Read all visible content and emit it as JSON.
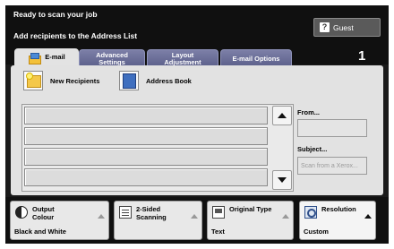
{
  "header": {
    "status_line": "Ready to scan your job",
    "instruction": "Add recipients to the Address List",
    "user_button": "Guest",
    "page_number": "1"
  },
  "tabs": [
    {
      "label": "E-mail",
      "active": true
    },
    {
      "label": "Advanced Settings",
      "active": false
    },
    {
      "label": "Layout Adjustment",
      "active": false
    },
    {
      "label": "E-mail Options",
      "active": false
    }
  ],
  "actions": {
    "new_recipients": "New Recipients",
    "address_book": "Address Book"
  },
  "recipient_list": {
    "rows": [
      "",
      "",
      "",
      ""
    ]
  },
  "fields": {
    "from_label": "From...",
    "from_value": "",
    "subject_label": "Subject...",
    "subject_placeholder": "Scan from a Xerox..."
  },
  "features": [
    {
      "title": "Output Colour",
      "value": "Black and White",
      "icon": "colour-icon"
    },
    {
      "title": "2-Sided Scanning",
      "value": "",
      "icon": "two-sided-icon"
    },
    {
      "title": "Original Type",
      "value": "Text",
      "icon": "original-type-icon"
    },
    {
      "title": "Resolution",
      "value": "Custom",
      "icon": "resolution-icon"
    }
  ],
  "colors": {
    "header_bg": "#101010",
    "tab_inactive": "#6b6f98",
    "panel_bg": "#e2e2e2"
  }
}
